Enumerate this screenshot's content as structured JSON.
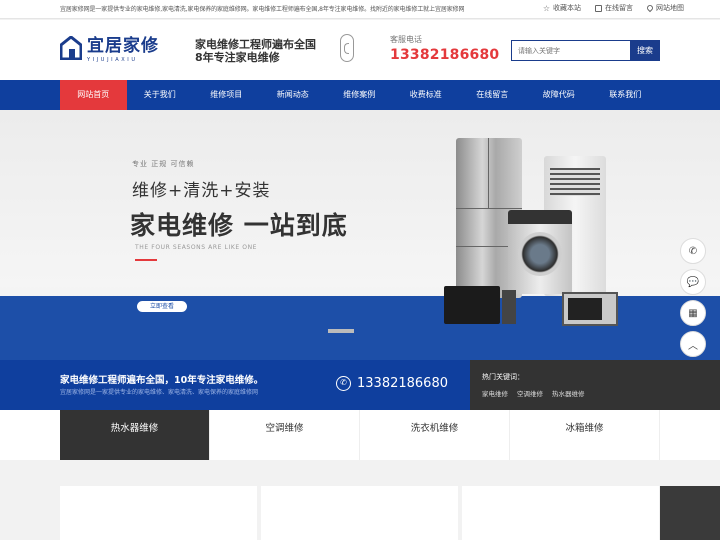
{
  "topbar": {
    "description": "宜居家修网是一家提供专业的家电维修,家电清洗,家电保养的家庭维修网。家电维修工程师遍布全国,8年专注家电维修。找附近的家电维修工就上宜居家修网",
    "links": [
      "收藏本站",
      "在线留言",
      "网站地图"
    ]
  },
  "header": {
    "logo_cn": "宜居家修",
    "logo_py": "YIJUJIAXIU",
    "slogan_line1": "家电维修工程师遍布全国",
    "slogan_line2": "8年专注家电维修",
    "hotline_label": "客服电话",
    "hotline_number": "13382186680",
    "search_placeholder": "请输入关键字",
    "search_button": "搜索"
  },
  "nav": {
    "items": [
      "网站首页",
      "关于我们",
      "维修项目",
      "新闻动态",
      "维修案例",
      "收费标准",
      "在线留言",
      "故障代码",
      "联系我们"
    ],
    "active": 0
  },
  "banner": {
    "tag": "专业 正规 可信赖",
    "line1": "维修+清洗+安装",
    "line2": "家电维修  一站到底",
    "en": "THE FOUR SEASONS ARE LIKE ONE",
    "more": "立即查看",
    "slides": 2,
    "active_slide": 1
  },
  "strip": {
    "title": "家电维修工程师遍布全国，10年专注家电维修。",
    "subtitle": "宜居家修网是一家提供专业的家电维修、家电清洗、家电保养的家庭维修网",
    "phone": "13382186680",
    "keywords_title": "热门关键词：",
    "keywords": [
      "家电维修",
      "空调维修",
      "热水器维修"
    ]
  },
  "tabs": {
    "items": [
      "热水器维修",
      "空调维修",
      "洗衣机维修",
      "冰箱维修"
    ],
    "active": 0
  },
  "colors": {
    "brand_blue": "#0f3f9e",
    "accent_red": "#e4393c",
    "dark": "#333333"
  }
}
